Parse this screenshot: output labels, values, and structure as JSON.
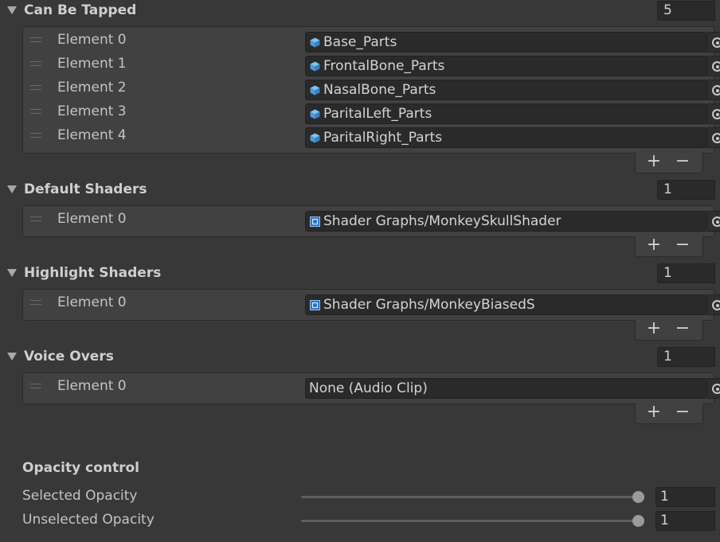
{
  "icons": {
    "prefab": "prefab-cube-icon",
    "shader": "shader-graph-icon",
    "picker": "object-picker-icon"
  },
  "sections": [
    {
      "title": "Can Be Tapped",
      "size": "5",
      "elements": [
        {
          "label": "Element 0",
          "value": "Base_Parts",
          "icon": "prefab"
        },
        {
          "label": "Element 1",
          "value": "FrontalBone_Parts",
          "icon": "prefab"
        },
        {
          "label": "Element 2",
          "value": "NasalBone_Parts",
          "icon": "prefab"
        },
        {
          "label": "Element 3",
          "value": "ParitalLeft_Parts",
          "icon": "prefab"
        },
        {
          "label": "Element 4",
          "value": "ParitalRight_Parts",
          "icon": "prefab"
        }
      ]
    },
    {
      "title": "Default Shaders",
      "size": "1",
      "elements": [
        {
          "label": "Element 0",
          "value": "Shader Graphs/MonkeySkullShader",
          "icon": "shader"
        }
      ]
    },
    {
      "title": "Highlight Shaders",
      "size": "1",
      "elements": [
        {
          "label": "Element 0",
          "value": "Shader Graphs/MonkeyBiasedS",
          "icon": "shader"
        }
      ]
    },
    {
      "title": "Voice Overs",
      "size": "1",
      "elements": [
        {
          "label": "Element 0",
          "value": "None (Audio Clip)",
          "icon": "none"
        }
      ]
    }
  ],
  "buttons": {
    "add": "+",
    "remove": "−"
  },
  "opacity": {
    "title": "Opacity control",
    "sliders": [
      {
        "label": "Selected Opacity",
        "value": "1",
        "fraction": 1.0
      },
      {
        "label": "Unselected Opacity",
        "value": "1",
        "fraction": 1.0
      }
    ]
  },
  "colors": {
    "background": "#383838",
    "field": "#2a2a2a",
    "prefab_icon": "#5aa9e6",
    "shader_icon": "#3c7fd0"
  }
}
